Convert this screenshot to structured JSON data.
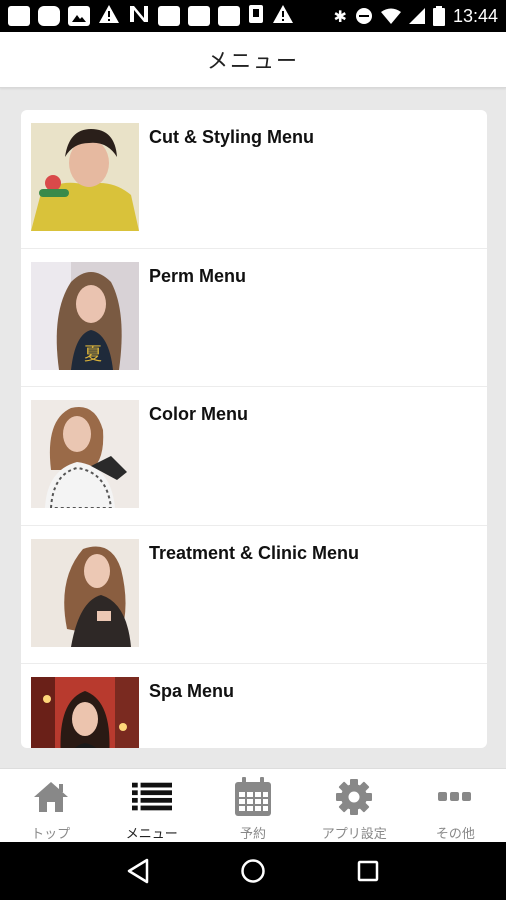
{
  "status_bar": {
    "time": "13:44"
  },
  "header": {
    "title": "メニュー"
  },
  "menu_items": [
    {
      "label": "Cut & Styling Menu"
    },
    {
      "label": "Perm Menu"
    },
    {
      "label": "Color Menu"
    },
    {
      "label": "Treatment & Clinic Menu"
    },
    {
      "label": "Spa Menu"
    }
  ],
  "bottom_nav": [
    {
      "label": "トップ",
      "icon": "home-icon"
    },
    {
      "label": "メニュー",
      "icon": "list-icon"
    },
    {
      "label": "予約",
      "icon": "calendar-icon"
    },
    {
      "label": "アプリ設定",
      "icon": "gear-icon"
    },
    {
      "label": "その他",
      "icon": "more-icon"
    }
  ],
  "colors": {
    "nav_icon_inactive": "#888888",
    "nav_icon_active": "#111111",
    "page_background": "#e8e8e8"
  }
}
